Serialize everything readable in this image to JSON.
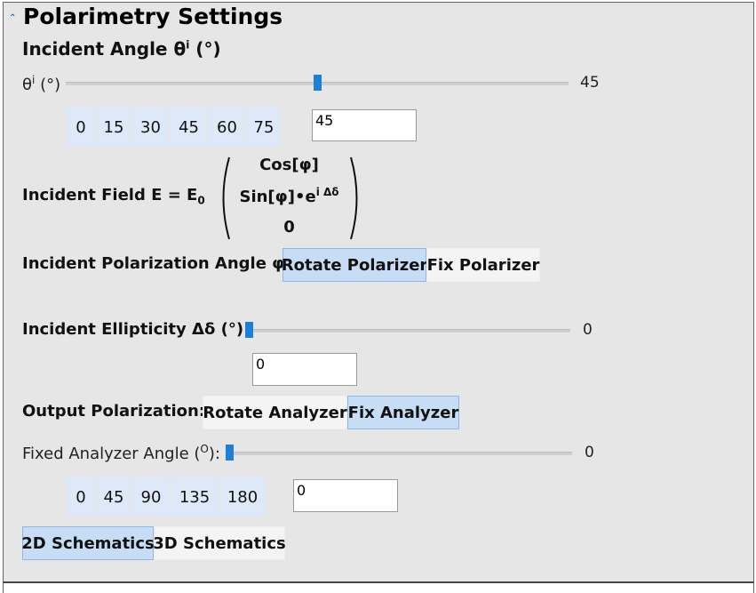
{
  "section": {
    "title": "Polarimetry Settings",
    "collapse_icon": "collapse-chevron-icon"
  },
  "incident_angle": {
    "heading": "Incident Angle θ",
    "heading_sup": "i",
    "heading_unit": "(°)",
    "slider_label": "θ",
    "slider_label_sup": "i",
    "slider_label_unit": "(°)",
    "value": 45,
    "min": 0,
    "max": 90,
    "readout": "45",
    "presets": [
      "0",
      "15",
      "30",
      "45",
      "60",
      "75"
    ],
    "input_value": "45"
  },
  "incident_field": {
    "label": "Incident Field E = E",
    "label_sub": "0",
    "row1": "Cos[φ]",
    "row2": "Sin[φ]•e",
    "row2_sup": "i Δδ",
    "row3": "0"
  },
  "polarization_angle": {
    "label": "Incident Polarization Angle φ:",
    "options": [
      "Rotate Polarizer",
      "Fix Polarizer"
    ],
    "selected": "Rotate Polarizer"
  },
  "ellipticity": {
    "label": "Incident Ellipticity Δδ (°):",
    "value": 0,
    "min": 0,
    "max": 90,
    "readout": "0",
    "input_value": "0"
  },
  "output_polarization": {
    "label": "Output Polarization:",
    "options": [
      "Rotate Analyzer",
      "Fix Analyzer"
    ],
    "selected": "Fix Analyzer"
  },
  "analyzer_angle": {
    "label": "Fixed Analyzer Angle (",
    "label_sup": "O",
    "label_end": "):",
    "value": 0,
    "min": 0,
    "max": 180,
    "readout": "0",
    "presets": [
      "0",
      "45",
      "90",
      "135",
      "180"
    ],
    "input_value": "0"
  },
  "schematics": {
    "options": [
      "2D Schematics",
      "3D Schematics"
    ],
    "selected": "2D Schematics"
  },
  "colors": {
    "panel_bg": "#e6e6e6",
    "slider_thumb": "#1e7fd6",
    "preset_bg": "#dde9f8",
    "toggle_selected": "#c7ddf5"
  }
}
